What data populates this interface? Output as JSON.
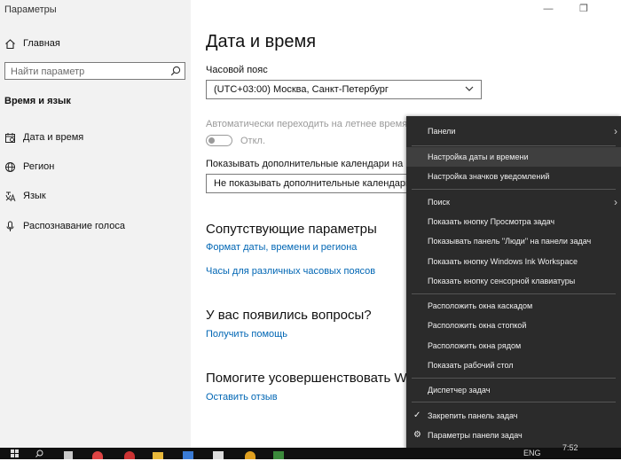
{
  "window": {
    "title": "Параметры",
    "minimize": "—",
    "restore": "❐",
    "close": "✕"
  },
  "sidebar": {
    "home_label": "Главная",
    "search_placeholder": "Найти параметр",
    "section_title": "Время и язык",
    "items": [
      {
        "label": "Дата и время",
        "icon": "calendar-icon"
      },
      {
        "label": "Регион",
        "icon": "globe-icon"
      },
      {
        "label": "Язык",
        "icon": "language-icon"
      },
      {
        "label": "Распознавание голоса",
        "icon": "microphone-icon"
      }
    ]
  },
  "main": {
    "title": "Дата и время",
    "timezone_label": "Часовой пояс",
    "timezone_value": "(UTC+03:00) Москва, Санкт-Петербург",
    "dst_label": "Автоматически переходить на летнее время и обр",
    "dst_toggle_state": "Откл.",
    "calendars_label": "Показывать дополнительные календари на панели",
    "calendars_value": "Не показывать дополнительные календари",
    "related_heading": "Сопутствующие параметры",
    "related_links": [
      "Формат даты, времени и региона",
      "Часы для различных часовых поясов"
    ],
    "questions_heading": "У вас появились вопросы?",
    "help_link": "Получить помощь",
    "improve_heading": "Помогите усовершенствовать Wind",
    "feedback_link": "Оставить отзыв"
  },
  "context_menu": {
    "items": [
      {
        "label": "Панели",
        "submenu": "›"
      },
      {
        "label": "Настройка даты и времени"
      },
      {
        "label": "Настройка значков уведомлений"
      },
      {
        "label": "Поиск",
        "submenu": "›"
      },
      {
        "label": "Показать кнопку Просмотра задач"
      },
      {
        "label": "Показывать панель \"Люди\" на панели задач"
      },
      {
        "label": "Показать кнопку Windows Ink Workspace"
      },
      {
        "label": "Показать кнопку сенсорной клавиатуры"
      },
      {
        "label": "Расположить окна каскадом"
      },
      {
        "label": "Расположить окна стопкой"
      },
      {
        "label": "Расположить окна рядом"
      },
      {
        "label": "Показать рабочий стол"
      },
      {
        "label": "Диспетчер задач"
      },
      {
        "label": "Закрепить панель задач",
        "lead": "✓"
      },
      {
        "label": "Параметры панели задач",
        "lead": "⚙"
      }
    ]
  },
  "taskbar": {
    "time": "7:52",
    "lang": "ENG"
  },
  "colors": {
    "link": "#0066b4",
    "menu_bg": "#2b2b2b",
    "sidebar_bg": "#f2f2f2"
  }
}
